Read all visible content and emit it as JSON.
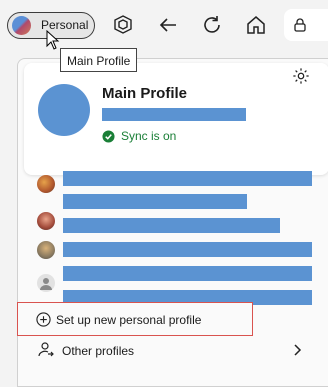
{
  "toolbar": {
    "profile_label": "Personal",
    "tooltip": "Main Profile",
    "icons": [
      "collections-icon",
      "back-icon",
      "refresh-icon",
      "home-icon",
      "lock-icon"
    ]
  },
  "panel": {
    "main_profile": {
      "name": "Main Profile",
      "sync_status": "Sync is on"
    },
    "other_profiles_count": 4,
    "actions": {
      "create": "Set up new personal profile",
      "other": "Other profiles"
    }
  },
  "colors": {
    "accent_blue": "#5b93d2",
    "sync_green": "#1a7f37",
    "highlight_red": "#d9534f"
  }
}
